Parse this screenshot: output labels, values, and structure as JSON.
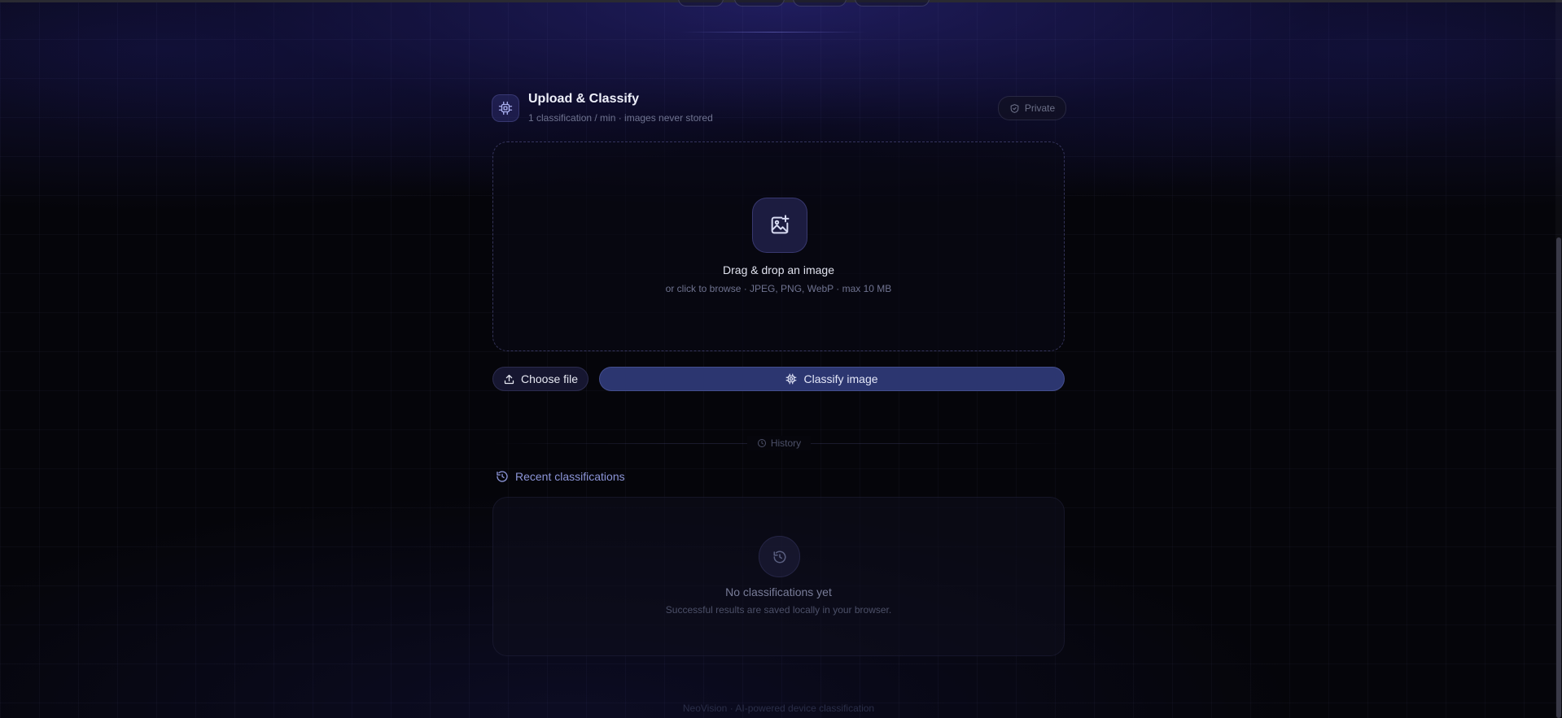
{
  "upload": {
    "title": "Upload & Classify",
    "subtitle": "1 classification / min · images never stored",
    "privacy_badge": "Private",
    "icon": "cpu-chip-icon"
  },
  "dropzone": {
    "title": "Drag & drop an image",
    "hint": "or click to browse · JPEG, PNG, WebP · max 10 MB",
    "icon": "image-plus-icon"
  },
  "actions": {
    "choose_file": "Choose file",
    "classify": "Classify image"
  },
  "history": {
    "section_label": "History",
    "heading": "Recent classifications",
    "empty_title": "No classifications yet",
    "empty_hint": "Successful results are saved locally in your browser."
  },
  "footer": {
    "text": "NeoVision · AI-powered device classification"
  },
  "theme": {
    "accent": "#2c3670",
    "heading_accent": "#8c95d8",
    "background": "#05050a"
  }
}
